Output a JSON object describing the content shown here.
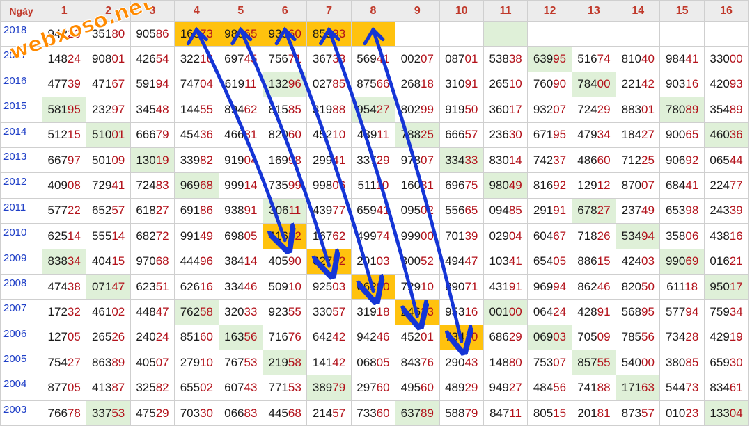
{
  "watermark_text": "webxoso.net",
  "header": {
    "day_label": "Ngày",
    "days": [
      "1",
      "2",
      "3",
      "4",
      "5",
      "6",
      "7",
      "8",
      "9",
      "10",
      "11",
      "12",
      "13",
      "14",
      "15",
      "16"
    ]
  },
  "colors": {
    "orange": "#ffc20e",
    "green": "#dff0d8",
    "year": "#1f3fc7",
    "red": "#b3121b",
    "arrow": "#1535d6",
    "watermark": "#ff8a00"
  },
  "rows": [
    {
      "year": "2018",
      "cells": [
        {
          "v": "94223",
          "hl": ""
        },
        {
          "v": "35180",
          "hl": ""
        },
        {
          "v": "90586",
          "hl": ""
        },
        {
          "v": "16873",
          "hl": "o"
        },
        {
          "v": "98565",
          "hl": "o"
        },
        {
          "v": "93060",
          "hl": "o"
        },
        {
          "v": "85983",
          "hl": "o"
        },
        {
          "v": "",
          "hl": "o"
        },
        {
          "v": "",
          "hl": ""
        },
        {
          "v": "",
          "hl": ""
        },
        {
          "v": "",
          "hl": "g"
        },
        {
          "v": "",
          "hl": ""
        },
        {
          "v": "",
          "hl": ""
        },
        {
          "v": "",
          "hl": ""
        },
        {
          "v": "",
          "hl": ""
        },
        {
          "v": "",
          "hl": ""
        }
      ]
    },
    {
      "year": "2017",
      "cells": [
        {
          "v": "14824",
          "hl": ""
        },
        {
          "v": "90801",
          "hl": ""
        },
        {
          "v": "42654",
          "hl": ""
        },
        {
          "v": "32216",
          "hl": ""
        },
        {
          "v": "69745",
          "hl": ""
        },
        {
          "v": "75671",
          "hl": ""
        },
        {
          "v": "36733",
          "hl": ""
        },
        {
          "v": "56941",
          "hl": ""
        },
        {
          "v": "00207",
          "hl": ""
        },
        {
          "v": "08701",
          "hl": ""
        },
        {
          "v": "53838",
          "hl": ""
        },
        {
          "v": "63995",
          "hl": "g"
        },
        {
          "v": "51674",
          "hl": ""
        },
        {
          "v": "81040",
          "hl": ""
        },
        {
          "v": "98441",
          "hl": ""
        },
        {
          "v": "33000",
          "hl": ""
        }
      ]
    },
    {
      "year": "2016",
      "cells": [
        {
          "v": "47739",
          "hl": ""
        },
        {
          "v": "47167",
          "hl": ""
        },
        {
          "v": "59194",
          "hl": ""
        },
        {
          "v": "74704",
          "hl": ""
        },
        {
          "v": "61911",
          "hl": ""
        },
        {
          "v": "13296",
          "hl": "g"
        },
        {
          "v": "02785",
          "hl": ""
        },
        {
          "v": "87566",
          "hl": ""
        },
        {
          "v": "26818",
          "hl": ""
        },
        {
          "v": "31091",
          "hl": ""
        },
        {
          "v": "26510",
          "hl": ""
        },
        {
          "v": "76090",
          "hl": ""
        },
        {
          "v": "78400",
          "hl": "g"
        },
        {
          "v": "22142",
          "hl": ""
        },
        {
          "v": "90316",
          "hl": ""
        },
        {
          "v": "42093",
          "hl": ""
        }
      ]
    },
    {
      "year": "2015",
      "cells": [
        {
          "v": "58195",
          "hl": "g"
        },
        {
          "v": "23297",
          "hl": ""
        },
        {
          "v": "34548",
          "hl": ""
        },
        {
          "v": "14455",
          "hl": ""
        },
        {
          "v": "89462",
          "hl": ""
        },
        {
          "v": "81585",
          "hl": ""
        },
        {
          "v": "31988",
          "hl": ""
        },
        {
          "v": "95427",
          "hl": "g"
        },
        {
          "v": "80299",
          "hl": ""
        },
        {
          "v": "91950",
          "hl": ""
        },
        {
          "v": "36017",
          "hl": ""
        },
        {
          "v": "93207",
          "hl": ""
        },
        {
          "v": "72429",
          "hl": ""
        },
        {
          "v": "88301",
          "hl": ""
        },
        {
          "v": "78089",
          "hl": "g"
        },
        {
          "v": "35489",
          "hl": ""
        }
      ]
    },
    {
      "year": "2014",
      "cells": [
        {
          "v": "51215",
          "hl": ""
        },
        {
          "v": "51001",
          "hl": "g"
        },
        {
          "v": "66679",
          "hl": ""
        },
        {
          "v": "45436",
          "hl": ""
        },
        {
          "v": "46681",
          "hl": ""
        },
        {
          "v": "82060",
          "hl": ""
        },
        {
          "v": "45210",
          "hl": ""
        },
        {
          "v": "48911",
          "hl": ""
        },
        {
          "v": "78825",
          "hl": "g"
        },
        {
          "v": "66657",
          "hl": ""
        },
        {
          "v": "23630",
          "hl": ""
        },
        {
          "v": "67195",
          "hl": ""
        },
        {
          "v": "47934",
          "hl": ""
        },
        {
          "v": "18427",
          "hl": ""
        },
        {
          "v": "90065",
          "hl": ""
        },
        {
          "v": "46036",
          "hl": "g"
        }
      ]
    },
    {
      "year": "2013",
      "cells": [
        {
          "v": "66797",
          "hl": ""
        },
        {
          "v": "50109",
          "hl": ""
        },
        {
          "v": "13019",
          "hl": "g"
        },
        {
          "v": "33982",
          "hl": ""
        },
        {
          "v": "91904",
          "hl": ""
        },
        {
          "v": "16998",
          "hl": ""
        },
        {
          "v": "29941",
          "hl": ""
        },
        {
          "v": "33729",
          "hl": ""
        },
        {
          "v": "97807",
          "hl": ""
        },
        {
          "v": "33433",
          "hl": "g"
        },
        {
          "v": "83014",
          "hl": ""
        },
        {
          "v": "74237",
          "hl": ""
        },
        {
          "v": "48660",
          "hl": ""
        },
        {
          "v": "71225",
          "hl": ""
        },
        {
          "v": "90692",
          "hl": ""
        },
        {
          "v": "06544",
          "hl": ""
        }
      ]
    },
    {
      "year": "2012",
      "cells": [
        {
          "v": "40908",
          "hl": ""
        },
        {
          "v": "72941",
          "hl": ""
        },
        {
          "v": "72483",
          "hl": ""
        },
        {
          "v": "96968",
          "hl": "g"
        },
        {
          "v": "99914",
          "hl": ""
        },
        {
          "v": "73599",
          "hl": ""
        },
        {
          "v": "99806",
          "hl": ""
        },
        {
          "v": "51110",
          "hl": ""
        },
        {
          "v": "16081",
          "hl": ""
        },
        {
          "v": "69675",
          "hl": ""
        },
        {
          "v": "98049",
          "hl": "g"
        },
        {
          "v": "81692",
          "hl": ""
        },
        {
          "v": "12912",
          "hl": ""
        },
        {
          "v": "87007",
          "hl": ""
        },
        {
          "v": "68441",
          "hl": ""
        },
        {
          "v": "22477",
          "hl": ""
        }
      ]
    },
    {
      "year": "2011",
      "cells": [
        {
          "v": "57722",
          "hl": ""
        },
        {
          "v": "65257",
          "hl": ""
        },
        {
          "v": "61827",
          "hl": ""
        },
        {
          "v": "69186",
          "hl": ""
        },
        {
          "v": "93891",
          "hl": ""
        },
        {
          "v": "30611",
          "hl": "g"
        },
        {
          "v": "43977",
          "hl": ""
        },
        {
          "v": "65941",
          "hl": ""
        },
        {
          "v": "09502",
          "hl": ""
        },
        {
          "v": "55665",
          "hl": ""
        },
        {
          "v": "09485",
          "hl": ""
        },
        {
          "v": "29191",
          "hl": ""
        },
        {
          "v": "67827",
          "hl": "g"
        },
        {
          "v": "23749",
          "hl": ""
        },
        {
          "v": "65398",
          "hl": ""
        },
        {
          "v": "24339",
          "hl": ""
        }
      ]
    },
    {
      "year": "2010",
      "cells": [
        {
          "v": "62514",
          "hl": ""
        },
        {
          "v": "55514",
          "hl": ""
        },
        {
          "v": "68272",
          "hl": ""
        },
        {
          "v": "99149",
          "hl": ""
        },
        {
          "v": "69805",
          "hl": ""
        },
        {
          "v": "41632",
          "hl": "o"
        },
        {
          "v": "16762",
          "hl": ""
        },
        {
          "v": "49974",
          "hl": ""
        },
        {
          "v": "99900",
          "hl": ""
        },
        {
          "v": "70139",
          "hl": ""
        },
        {
          "v": "02904",
          "hl": ""
        },
        {
          "v": "60467",
          "hl": ""
        },
        {
          "v": "71826",
          "hl": ""
        },
        {
          "v": "53494",
          "hl": "g"
        },
        {
          "v": "35806",
          "hl": ""
        },
        {
          "v": "43816",
          "hl": ""
        }
      ]
    },
    {
      "year": "2009",
      "cells": [
        {
          "v": "83834",
          "hl": "g"
        },
        {
          "v": "40415",
          "hl": ""
        },
        {
          "v": "97068",
          "hl": ""
        },
        {
          "v": "44496",
          "hl": ""
        },
        {
          "v": "38414",
          "hl": ""
        },
        {
          "v": "40590",
          "hl": ""
        },
        {
          "v": "62752",
          "hl": "o"
        },
        {
          "v": "20103",
          "hl": ""
        },
        {
          "v": "30052",
          "hl": ""
        },
        {
          "v": "49447",
          "hl": ""
        },
        {
          "v": "10341",
          "hl": ""
        },
        {
          "v": "65405",
          "hl": ""
        },
        {
          "v": "88615",
          "hl": ""
        },
        {
          "v": "42403",
          "hl": ""
        },
        {
          "v": "99069",
          "hl": "g"
        },
        {
          "v": "01621",
          "hl": ""
        }
      ]
    },
    {
      "year": "2008",
      "cells": [
        {
          "v": "47438",
          "hl": ""
        },
        {
          "v": "07147",
          "hl": "g"
        },
        {
          "v": "62351",
          "hl": ""
        },
        {
          "v": "62616",
          "hl": ""
        },
        {
          "v": "33446",
          "hl": ""
        },
        {
          "v": "50910",
          "hl": ""
        },
        {
          "v": "92503",
          "hl": ""
        },
        {
          "v": "66280",
          "hl": "o"
        },
        {
          "v": "72910",
          "hl": ""
        },
        {
          "v": "89071",
          "hl": ""
        },
        {
          "v": "43191",
          "hl": ""
        },
        {
          "v": "96994",
          "hl": ""
        },
        {
          "v": "86246",
          "hl": ""
        },
        {
          "v": "82050",
          "hl": ""
        },
        {
          "v": "61118",
          "hl": ""
        },
        {
          "v": "95017",
          "hl": "g"
        }
      ]
    },
    {
      "year": "2007",
      "cells": [
        {
          "v": "17232",
          "hl": ""
        },
        {
          "v": "46102",
          "hl": ""
        },
        {
          "v": "44847",
          "hl": ""
        },
        {
          "v": "76258",
          "hl": "g"
        },
        {
          "v": "32033",
          "hl": ""
        },
        {
          "v": "92355",
          "hl": ""
        },
        {
          "v": "33057",
          "hl": ""
        },
        {
          "v": "31918",
          "hl": ""
        },
        {
          "v": "24623",
          "hl": "o"
        },
        {
          "v": "95316",
          "hl": ""
        },
        {
          "v": "00100",
          "hl": "g"
        },
        {
          "v": "06424",
          "hl": ""
        },
        {
          "v": "42891",
          "hl": ""
        },
        {
          "v": "56895",
          "hl": ""
        },
        {
          "v": "57794",
          "hl": ""
        },
        {
          "v": "75934",
          "hl": ""
        }
      ]
    },
    {
      "year": "2006",
      "cells": [
        {
          "v": "12705",
          "hl": ""
        },
        {
          "v": "26526",
          "hl": ""
        },
        {
          "v": "24024",
          "hl": ""
        },
        {
          "v": "85160",
          "hl": ""
        },
        {
          "v": "16356",
          "hl": "g"
        },
        {
          "v": "71676",
          "hl": ""
        },
        {
          "v": "64242",
          "hl": ""
        },
        {
          "v": "94246",
          "hl": ""
        },
        {
          "v": "45201",
          "hl": ""
        },
        {
          "v": "73410",
          "hl": "o"
        },
        {
          "v": "68629",
          "hl": ""
        },
        {
          "v": "06903",
          "hl": "g"
        },
        {
          "v": "70509",
          "hl": ""
        },
        {
          "v": "78556",
          "hl": ""
        },
        {
          "v": "73428",
          "hl": ""
        },
        {
          "v": "42919",
          "hl": ""
        }
      ]
    },
    {
      "year": "2005",
      "cells": [
        {
          "v": "75427",
          "hl": ""
        },
        {
          "v": "86389",
          "hl": ""
        },
        {
          "v": "40507",
          "hl": ""
        },
        {
          "v": "27910",
          "hl": ""
        },
        {
          "v": "76753",
          "hl": ""
        },
        {
          "v": "21958",
          "hl": "g"
        },
        {
          "v": "14142",
          "hl": ""
        },
        {
          "v": "06805",
          "hl": ""
        },
        {
          "v": "84376",
          "hl": ""
        },
        {
          "v": "29043",
          "hl": ""
        },
        {
          "v": "14880",
          "hl": ""
        },
        {
          "v": "75307",
          "hl": ""
        },
        {
          "v": "85755",
          "hl": "g"
        },
        {
          "v": "54000",
          "hl": ""
        },
        {
          "v": "38085",
          "hl": ""
        },
        {
          "v": "65930",
          "hl": ""
        }
      ]
    },
    {
      "year": "2004",
      "cells": [
        {
          "v": "87705",
          "hl": ""
        },
        {
          "v": "41387",
          "hl": ""
        },
        {
          "v": "32582",
          "hl": ""
        },
        {
          "v": "65502",
          "hl": ""
        },
        {
          "v": "60743",
          "hl": ""
        },
        {
          "v": "77153",
          "hl": ""
        },
        {
          "v": "38979",
          "hl": "g"
        },
        {
          "v": "29760",
          "hl": ""
        },
        {
          "v": "49560",
          "hl": ""
        },
        {
          "v": "48929",
          "hl": ""
        },
        {
          "v": "94927",
          "hl": ""
        },
        {
          "v": "48456",
          "hl": ""
        },
        {
          "v": "74188",
          "hl": ""
        },
        {
          "v": "17163",
          "hl": "g"
        },
        {
          "v": "54473",
          "hl": ""
        },
        {
          "v": "83461",
          "hl": ""
        }
      ]
    },
    {
      "year": "2003",
      "cells": [
        {
          "v": "76678",
          "hl": ""
        },
        {
          "v": "33753",
          "hl": "g"
        },
        {
          "v": "47529",
          "hl": ""
        },
        {
          "v": "70330",
          "hl": ""
        },
        {
          "v": "06683",
          "hl": ""
        },
        {
          "v": "44568",
          "hl": ""
        },
        {
          "v": "21457",
          "hl": ""
        },
        {
          "v": "73360",
          "hl": ""
        },
        {
          "v": "63789",
          "hl": "g"
        },
        {
          "v": "58879",
          "hl": ""
        },
        {
          "v": "84711",
          "hl": ""
        },
        {
          "v": "80515",
          "hl": ""
        },
        {
          "v": "20181",
          "hl": ""
        },
        {
          "v": "87357",
          "hl": ""
        },
        {
          "v": "01023",
          "hl": ""
        },
        {
          "v": "13304",
          "hl": "g"
        }
      ]
    }
  ],
  "arrows": [
    {
      "from": {
        "year": "2018",
        "day": 4
      },
      "to": {
        "year": "2010",
        "day": 6
      }
    },
    {
      "from": {
        "year": "2018",
        "day": 5
      },
      "to": {
        "year": "2009",
        "day": 7
      }
    },
    {
      "from": {
        "year": "2018",
        "day": 6
      },
      "to": {
        "year": "2008",
        "day": 8
      }
    },
    {
      "from": {
        "year": "2018",
        "day": 7
      },
      "to": {
        "year": "2007",
        "day": 9
      }
    },
    {
      "from": {
        "year": "2018",
        "day": 8
      },
      "to": {
        "year": "2006",
        "day": 10
      }
    }
  ]
}
